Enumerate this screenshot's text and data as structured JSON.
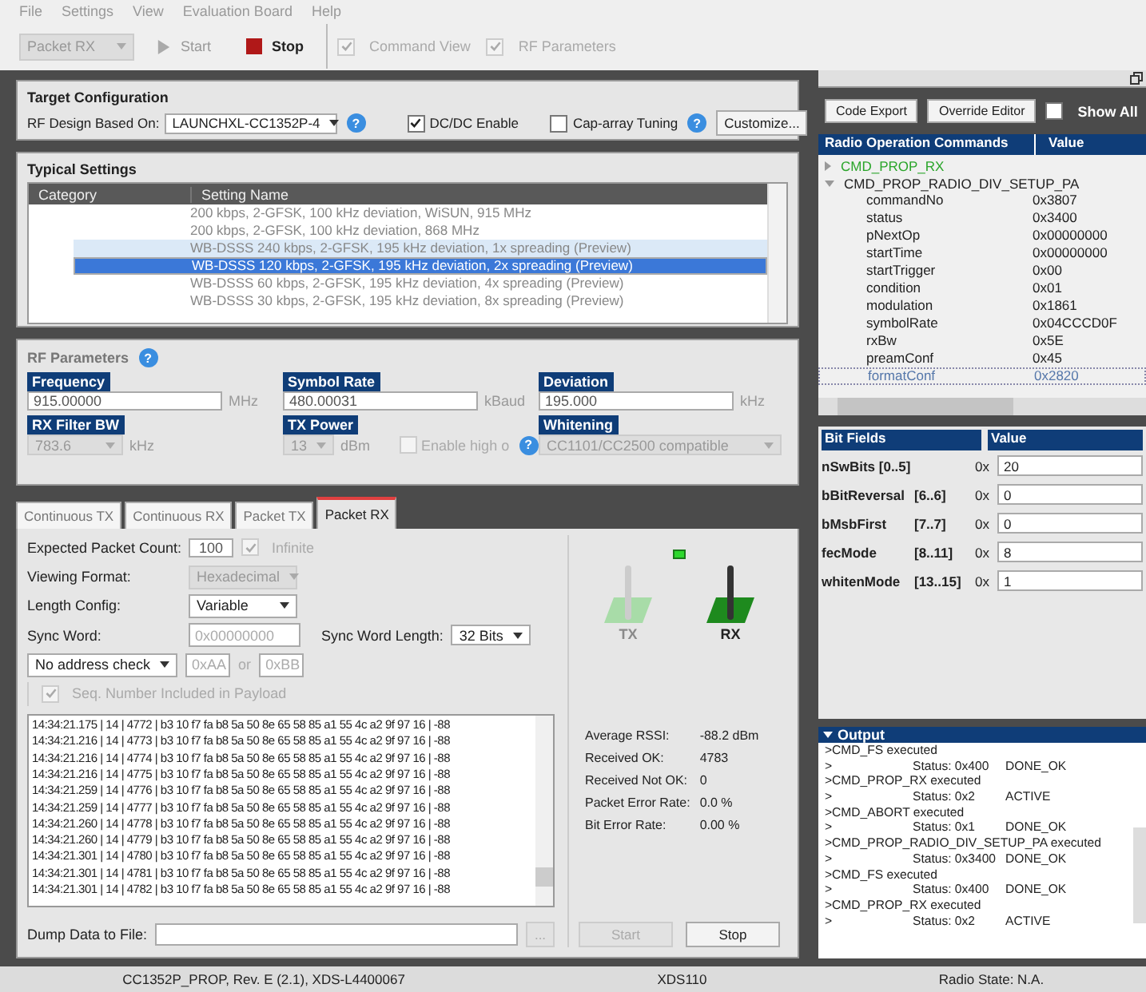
{
  "menu": [
    "File",
    "Settings",
    "View",
    "Evaluation Board",
    "Help"
  ],
  "toolbar": {
    "mode": "Packet RX",
    "start": {
      "label": "Start",
      "disabled": true
    },
    "stop": {
      "label": "Stop",
      "disabled": false
    },
    "checks": [
      {
        "label": "Command View",
        "checked": true
      },
      {
        "label": "RF Parameters",
        "checked": true
      }
    ]
  },
  "target_configuration": {
    "title": "Target Configuration",
    "design_label": "RF Design Based On:",
    "design_value": "LAUNCHXL-CC1352P-4",
    "design_help": "?",
    "options": [
      {
        "label": "DC/DC Enable",
        "checked": true
      },
      {
        "label": "Cap-array Tuning",
        "checked": false,
        "help": "?"
      }
    ],
    "customize": "Customize..."
  },
  "typical_settings": {
    "title": "Typical Settings",
    "columns": [
      "Category",
      "Setting Name"
    ],
    "rows": [
      {
        "name": "200 kbps, 2-GFSK, 100 kHz deviation, WiSUN, 915 MHz",
        "highlighted": false,
        "selected": false
      },
      {
        "name": "200 kbps, 2-GFSK, 100 kHz deviation, 868 MHz",
        "highlighted": false,
        "selected": false
      },
      {
        "name": "WB-DSSS 240 kbps, 2-GFSK, 195 kHz deviation, 1x spreading (Preview)",
        "highlighted": true,
        "selected": false
      },
      {
        "name": "WB-DSSS 120 kbps, 2-GFSK, 195 kHz deviation, 2x spreading (Preview)",
        "highlighted": false,
        "selected": true
      },
      {
        "name": "WB-DSSS 60 kbps, 2-GFSK, 195 kHz deviation, 4x spreading (Preview)",
        "highlighted": false,
        "selected": false
      },
      {
        "name": "WB-DSSS 30 kbps, 2-GFSK, 195 kHz deviation, 8x spreading (Preview)",
        "highlighted": false,
        "selected": false
      }
    ]
  },
  "rf_parameters": {
    "title": "RF Parameters",
    "help": "?",
    "fields": [
      {
        "label": "Frequency",
        "value": "915.00000",
        "unit": "MHz",
        "kind": "input",
        "disabled": false
      },
      {
        "label": "Symbol Rate",
        "value": "480.00031",
        "unit": "kBaud",
        "kind": "input",
        "disabled": false
      },
      {
        "label": "Deviation",
        "value": "195.000",
        "unit": "kHz",
        "kind": "input",
        "disabled": false
      },
      {
        "label": "RX Filter BW",
        "value": "783.6",
        "unit": "kHz",
        "kind": "select",
        "disabled": true
      },
      {
        "label": "TX Power",
        "value": "13",
        "unit": "dBm",
        "kind": "select",
        "disabled": true,
        "option": {
          "label": "Enable high o",
          "checked": false,
          "help": "?"
        }
      },
      {
        "label": "Whitening",
        "value": "CC1101/CC2500 compatible",
        "kind": "select",
        "disabled": true
      }
    ]
  },
  "tabs": [
    {
      "label": "Continuous TX",
      "selected": false
    },
    {
      "label": "Continuous RX",
      "selected": false
    },
    {
      "label": "Packet TX",
      "selected": false
    },
    {
      "label": "Packet RX",
      "selected": true
    }
  ],
  "packet_rx": {
    "expected_label": "Expected Packet Count:",
    "expected_value": "100",
    "infinite": {
      "label": "Infinite",
      "checked": true
    },
    "viewing_label": "Viewing Format:",
    "viewing_value": "Hexadecimal",
    "length_label": "Length Config:",
    "length_value": "Variable",
    "sync_label": "Sync Word:",
    "sync_value": "0x00000000",
    "sync_length_label": "Sync Word Length:",
    "sync_length_value": "32 Bits",
    "address_check": "No address check",
    "address_1": "0xAA",
    "address_or": "or",
    "address_2": "0xBB",
    "seq_number": {
      "label": "Seq. Number Included in Payload",
      "checked": true
    },
    "log": [
      "14:34:21.175 | 14 | 4772 | b3 10 f7 fa b8 5a 50 8e 65 58 85 a1 55 4c a2 9f 97 16  |  -88",
      "14:34:21.216 | 14 | 4773 | b3 10 f7 fa b8 5a 50 8e 65 58 85 a1 55 4c a2 9f 97 16  |  -88",
      "14:34:21.216 | 14 | 4774 | b3 10 f7 fa b8 5a 50 8e 65 58 85 a1 55 4c a2 9f 97 16  |  -88",
      "14:34:21.216 | 14 | 4775 | b3 10 f7 fa b8 5a 50 8e 65 58 85 a1 55 4c a2 9f 97 16  |  -88",
      "14:34:21.259 | 14 | 4776 | b3 10 f7 fa b8 5a 50 8e 65 58 85 a1 55 4c a2 9f 97 16  |  -88",
      "14:34:21.259 | 14 | 4777 | b3 10 f7 fa b8 5a 50 8e 65 58 85 a1 55 4c a2 9f 97 16  |  -88",
      "14:34:21.260 | 14 | 4778 | b3 10 f7 fa b8 5a 50 8e 65 58 85 a1 55 4c a2 9f 97 16  |  -88",
      "14:34:21.260 | 14 | 4779 | b3 10 f7 fa b8 5a 50 8e 65 58 85 a1 55 4c a2 9f 97 16  |  -88",
      "14:34:21.301 | 14 | 4780 | b3 10 f7 fa b8 5a 50 8e 65 58 85 a1 55 4c a2 9f 97 16  |  -88",
      "14:34:21.301 | 14 | 4781 | b3 10 f7 fa b8 5a 50 8e 65 58 85 a1 55 4c a2 9f 97 16  |  -88",
      "14:34:21.301 | 14 | 4782 | b3 10 f7 fa b8 5a 50 8e 65 58 85 a1 55 4c a2 9f 97 16  |  -88"
    ],
    "dump_label": "Dump Data to File:",
    "browse": "...",
    "indicator_on": true,
    "switches": [
      {
        "label": "TX",
        "active": false
      },
      {
        "label": "RX",
        "active": true
      }
    ],
    "stats": [
      {
        "label": "Average RSSI:",
        "value": "-88.2 dBm"
      },
      {
        "label": "Received OK:",
        "value": "4783"
      },
      {
        "label": "Received Not OK:",
        "value": "0"
      },
      {
        "label": "Packet Error Rate:",
        "value": "0.0 %"
      },
      {
        "label": "Bit Error Rate:",
        "value": "0.00 %"
      }
    ],
    "start": {
      "label": "Start",
      "disabled": true
    },
    "stop": {
      "label": "Stop",
      "disabled": false
    }
  },
  "commands": {
    "code_export": "Code Export",
    "override_editor": "Override Editor",
    "show_all": {
      "label": "Show All",
      "checked": false
    },
    "columns": [
      "Radio Operation Commands",
      "Value"
    ],
    "tree": [
      {
        "name": "CMD_PROP_RX",
        "active": true,
        "expanded": false
      },
      {
        "name": "CMD_PROP_RADIO_DIV_SETUP_PA",
        "active": false,
        "expanded": true,
        "children": [
          {
            "name": "commandNo",
            "value": "0x3807",
            "selected": false
          },
          {
            "name": "status",
            "value": "0x3400",
            "selected": false
          },
          {
            "name": "pNextOp",
            "value": "0x00000000",
            "selected": false
          },
          {
            "name": "startTime",
            "value": "0x00000000",
            "selected": false
          },
          {
            "name": "startTrigger",
            "value": "0x00",
            "selected": false
          },
          {
            "name": "condition",
            "value": "0x01",
            "selected": false
          },
          {
            "name": "modulation",
            "value": "0x1861",
            "selected": false
          },
          {
            "name": "symbolRate",
            "value": "0x04CCCD0F",
            "selected": false
          },
          {
            "name": "rxBw",
            "value": "0x5E",
            "selected": false
          },
          {
            "name": "preamConf",
            "value": "0x45",
            "selected": false
          },
          {
            "name": "formatConf",
            "value": "0x2820",
            "selected": true
          }
        ]
      }
    ]
  },
  "bit_fields": {
    "columns": [
      "Bit Fields",
      "Value"
    ],
    "rows": [
      {
        "name": "nSwBits [0..5]",
        "prefix": "0x",
        "value": "20"
      },
      {
        "name": "bBitReversal",
        "range": "[6..6]",
        "prefix": "0x",
        "value": "0"
      },
      {
        "name": "bMsbFirst",
        "range": "[7..7]",
        "prefix": "0x",
        "value": "0"
      },
      {
        "name": "fecMode",
        "range": "[8..11]",
        "prefix": "0x",
        "value": "8"
      },
      {
        "name": "whitenMode",
        "range": "[13..15]",
        "prefix": "0x",
        "value": "1"
      }
    ]
  },
  "output": {
    "title": "Output",
    "lines": [
      {
        "kind": "event",
        "text": ">CMD_FS executed"
      },
      {
        "kind": "status",
        "prefix": ">",
        "status": "Status: 0x400",
        "result": "DONE_OK"
      },
      {
        "kind": "event",
        "text": ">CMD_PROP_RX executed"
      },
      {
        "kind": "status",
        "prefix": ">",
        "status": "Status: 0x2",
        "result": "ACTIVE"
      },
      {
        "kind": "event",
        "text": ">CMD_ABORT executed"
      },
      {
        "kind": "status",
        "prefix": ">",
        "status": "Status: 0x1",
        "result": "DONE_OK"
      },
      {
        "kind": "event",
        "text": ">CMD_PROP_RADIO_DIV_SETUP_PA executed"
      },
      {
        "kind": "status",
        "prefix": ">",
        "status": "Status: 0x3400",
        "result": "DONE_OK"
      },
      {
        "kind": "event",
        "text": ">CMD_FS executed"
      },
      {
        "kind": "status",
        "prefix": ">",
        "status": "Status: 0x400",
        "result": "DONE_OK"
      },
      {
        "kind": "event",
        "text": ">CMD_PROP_RX executed"
      },
      {
        "kind": "status",
        "prefix": ">",
        "status": "Status: 0x2",
        "result": "ACTIVE"
      }
    ]
  },
  "status_bar": [
    "CC1352P_PROP, Rev. E (2.1), XDS-L4400067",
    "XDS110",
    "Radio State: N.A."
  ]
}
